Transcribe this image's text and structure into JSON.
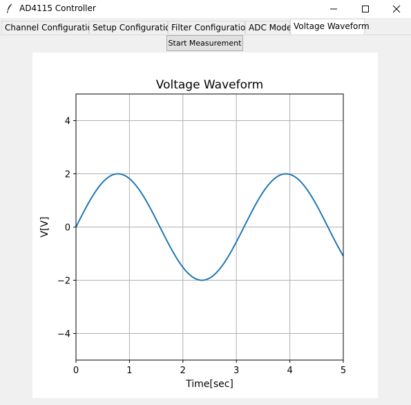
{
  "window": {
    "title": "AD4115 Controller",
    "controls": {
      "minimize_icon": "minimize-icon",
      "maximize_icon": "maximize-icon",
      "close_icon": "close-icon"
    }
  },
  "tabs": [
    {
      "label": "Channel Configuration",
      "active": false
    },
    {
      "label": "Setup Configuration",
      "active": false
    },
    {
      "label": "Filter Configuration",
      "active": false
    },
    {
      "label": "ADC Mode",
      "active": false
    },
    {
      "label": "Voltage Waveform",
      "active": true
    }
  ],
  "toolbar": {
    "start_label": "Start Measurement"
  },
  "colors": {
    "line": "#1f77b4",
    "grid": "#b0b0b0",
    "window_bg": "#f0f0f0"
  },
  "chart_data": {
    "type": "line",
    "title": "Voltage Waveform",
    "xlabel": "Time[sec]",
    "ylabel": "V[V]",
    "xlim": [
      0,
      5
    ],
    "ylim": [
      -5,
      5
    ],
    "xticks": [
      0,
      1,
      2,
      3,
      4,
      5
    ],
    "yticks": [
      -4,
      -2,
      0,
      2,
      4
    ],
    "ytick_labels": [
      "−4",
      "−2",
      "0",
      "2",
      "4"
    ],
    "grid": true,
    "series": [
      {
        "function": "2*sin(2*t)",
        "x": [
          0,
          0.25,
          0.5,
          0.75,
          1.0,
          1.25,
          1.5,
          1.75,
          2.0,
          2.25,
          2.5,
          2.75,
          3.0,
          3.25,
          3.5,
          3.75,
          4.0,
          4.25,
          4.5,
          4.75,
          5.0
        ],
        "y": [
          0,
          0.96,
          1.68,
          1.99,
          1.82,
          1.2,
          0.28,
          -0.7,
          -1.51,
          -1.95,
          -1.92,
          -1.41,
          -0.56,
          0.43,
          1.31,
          1.88,
          1.98,
          1.59,
          0.82,
          -0.14,
          -1.09
        ]
      }
    ]
  }
}
